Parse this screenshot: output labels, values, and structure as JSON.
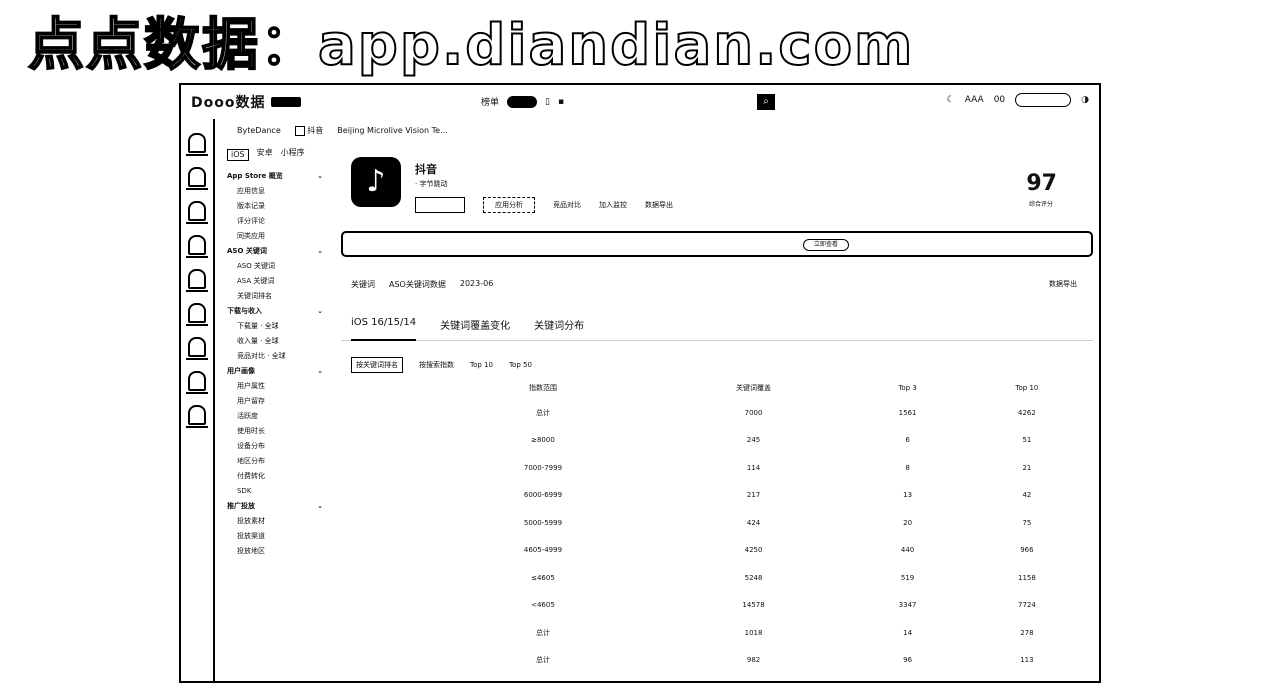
{
  "headline": "点点数据：app.diandian.com",
  "topbar": {
    "logo": "Dooo数据",
    "mid_label": "榜单",
    "right_items": [
      "AAA",
      "00"
    ]
  },
  "breadcrumbs": [
    "ByteDance",
    "抖音",
    "Beijing Microlive Vision Te..."
  ],
  "sidebar": {
    "tabs": [
      "iOS",
      "安卓",
      "小程序"
    ],
    "groups": [
      {
        "title": "App Store 概览",
        "items": [
          "应用信息",
          "版本记录",
          "评分评论",
          "同类应用"
        ]
      },
      {
        "title": "ASO 关键词",
        "items": [
          "ASO 关键词",
          "ASA 关键词",
          "关键词排名"
        ]
      },
      {
        "title": "下载与收入",
        "items": [
          "下载量 · 全球",
          "收入量 · 全球",
          "竞品对比 · 全球"
        ]
      },
      {
        "title": "用户画像",
        "items": [
          "用户属性",
          "用户留存",
          "活跃度",
          "使用时长",
          "设备分布",
          "地区分布",
          "付费转化",
          "SDK"
        ]
      },
      {
        "title": "推广投放",
        "items": [
          "投放素材",
          "投放渠道",
          "投放地区"
        ]
      }
    ]
  },
  "app": {
    "name": "抖音",
    "sub": "· 字节跳动",
    "actions": [
      "应用分析",
      "竞品对比",
      "加入监控",
      "数据导出"
    ],
    "score": "97",
    "score_label": "综合评分"
  },
  "banner": {
    "pill": "立即查看"
  },
  "keywords": {
    "title": "关键词",
    "items": [
      "ASO关键词数据",
      "2023-06"
    ],
    "right": "数据导出"
  },
  "tabs": [
    "iOS 16/15/14",
    "关键词覆盖变化",
    "关键词分布"
  ],
  "filters": [
    "按关键词排名",
    "按搜索指数",
    "Top 10",
    "Top 50"
  ],
  "table": {
    "headers": [
      "",
      "指数范围",
      "关键词覆盖",
      "",
      "",
      "Top 3",
      "",
      "",
      "Top 10",
      "",
      ""
    ],
    "rows": [
      {
        "group": "",
        "range": "总计",
        "a": "7000",
        "a1": "",
        "a2": "",
        "b": "1561",
        "b1": "",
        "b2": "",
        "c": "4262",
        "c1": "",
        "c2": ""
      },
      {
        "group": "",
        "range": "≥8000",
        "a": "245",
        "a1": "",
        "a2": "",
        "b": "6",
        "b1": "",
        "b2": "",
        "c": "51",
        "c1": "",
        "c2": ""
      },
      {
        "group": "",
        "range": "7000-7999",
        "a": "114",
        "a1": "",
        "a2": "",
        "b": "8",
        "b1": "",
        "b2": "",
        "c": "21",
        "c1": "",
        "c2": ""
      },
      {
        "group": "",
        "range": "6000-6999",
        "a": "217",
        "a1": "",
        "a2": "",
        "b": "13",
        "b1": "",
        "b2": "",
        "c": "42",
        "c1": "",
        "c2": ""
      },
      {
        "group": "",
        "range": "5000-5999",
        "a": "424",
        "a1": "",
        "a2": "",
        "b": "20",
        "b1": "",
        "b2": "",
        "c": "75",
        "c1": "",
        "c2": ""
      },
      {
        "group": "",
        "range": "4605-4999",
        "a": "4250",
        "a1": "",
        "a2": "",
        "b": "440",
        "b1": "",
        "b2": "",
        "c": "966",
        "c1": "",
        "c2": ""
      },
      {
        "group": "",
        "range": "≤4605",
        "a": "5248",
        "a1": "",
        "a2": "",
        "b": "519",
        "b1": "",
        "b2": "",
        "c": "1158",
        "c1": "",
        "c2": ""
      },
      {
        "group": "",
        "range": "<4605",
        "a": "14578",
        "a1": "",
        "a2": "",
        "b": "3347",
        "b1": "",
        "b2": "",
        "c": "7724",
        "c1": "",
        "c2": ""
      },
      {
        "group": "",
        "range": "总计",
        "a": "1018",
        "a1": "",
        "a2": "",
        "b": "14",
        "b1": "",
        "b2": "",
        "c": "278",
        "c1": "",
        "c2": ""
      },
      {
        "group": "",
        "range": "总计",
        "a": "982",
        "a1": "",
        "a2": "",
        "b": "96",
        "b1": "",
        "b2": "",
        "c": "113",
        "c1": "",
        "c2": ""
      }
    ]
  }
}
